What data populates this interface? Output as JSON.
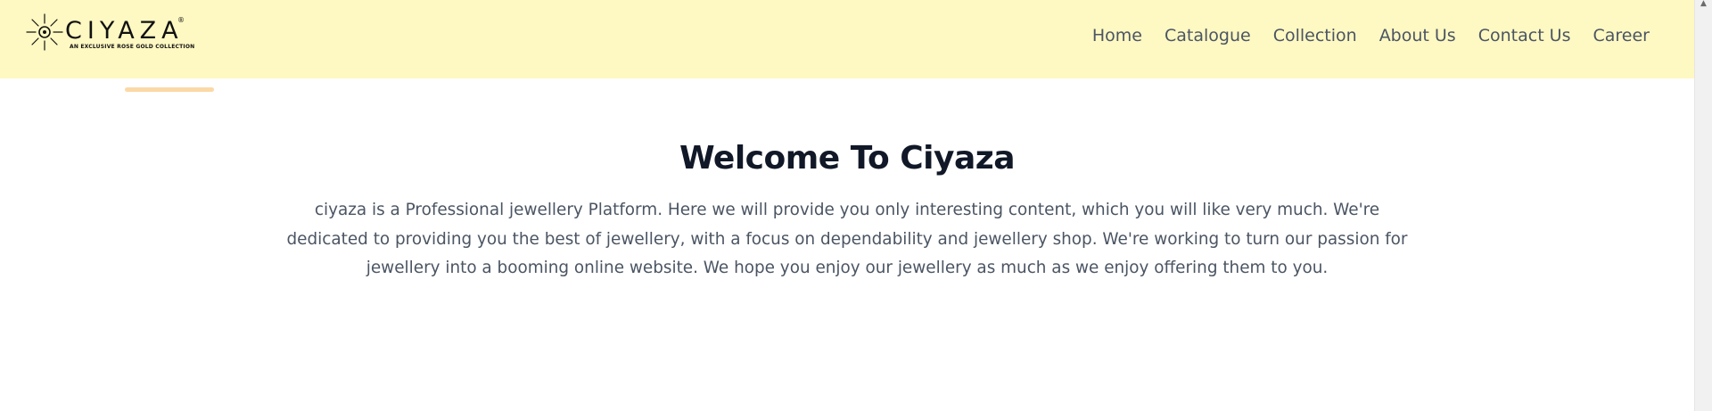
{
  "header": {
    "background_color": "#fef8c2",
    "logo": {
      "wordmark": "CIYAZA",
      "registered": "®",
      "tagline": "AN EXCLUSIVE ROSE GOLD COLLECTION",
      "icon": "sun-star-icon"
    },
    "nav": [
      {
        "label": "Home"
      },
      {
        "label": "Catalogue"
      },
      {
        "label": "Collection"
      },
      {
        "label": "About Us"
      },
      {
        "label": "Contact Us"
      },
      {
        "label": "Career"
      }
    ]
  },
  "accent_color": "#fbd9a6",
  "main": {
    "title": "Welcome To Ciyaza",
    "body": "ciyaza is a Professional jewellery Platform. Here we will provide you only interesting content, which you will like very much. We're dedicated to providing you the best of jewellery, with a focus on dependability and jewellery shop. We're working to turn our passion for jewellery into a booming online website. We hope you enjoy our jewellery as much as we enjoy offering them to you."
  },
  "scrollbar": {
    "up_arrow_icon": "scroll-up-arrow-icon",
    "up_arrow_glyph": "▲"
  }
}
